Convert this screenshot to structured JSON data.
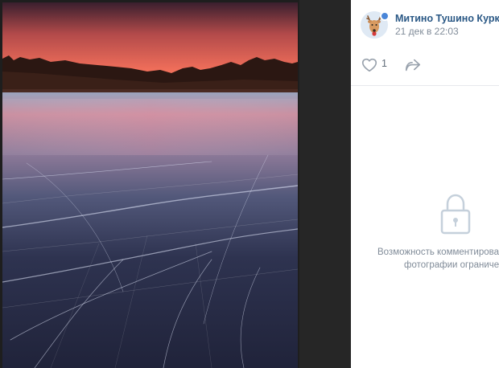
{
  "post": {
    "author_name": "Митино Тушино Куркино",
    "date": "21 дек в 22:03",
    "avatar_icon": "deer-avatar",
    "verified_icon": "verified-badge-icon"
  },
  "actions": {
    "like_icon": "heart-icon",
    "like_count": "1",
    "share_icon": "share-arrow-icon"
  },
  "comments": {
    "lock_icon": "lock-icon",
    "line1": "Возможность комментирован",
    "line2": "фотографии ограничен"
  },
  "colors": {
    "link": "#2a5885",
    "secondary_text": "#818c99",
    "viewer_background": "#222222"
  }
}
